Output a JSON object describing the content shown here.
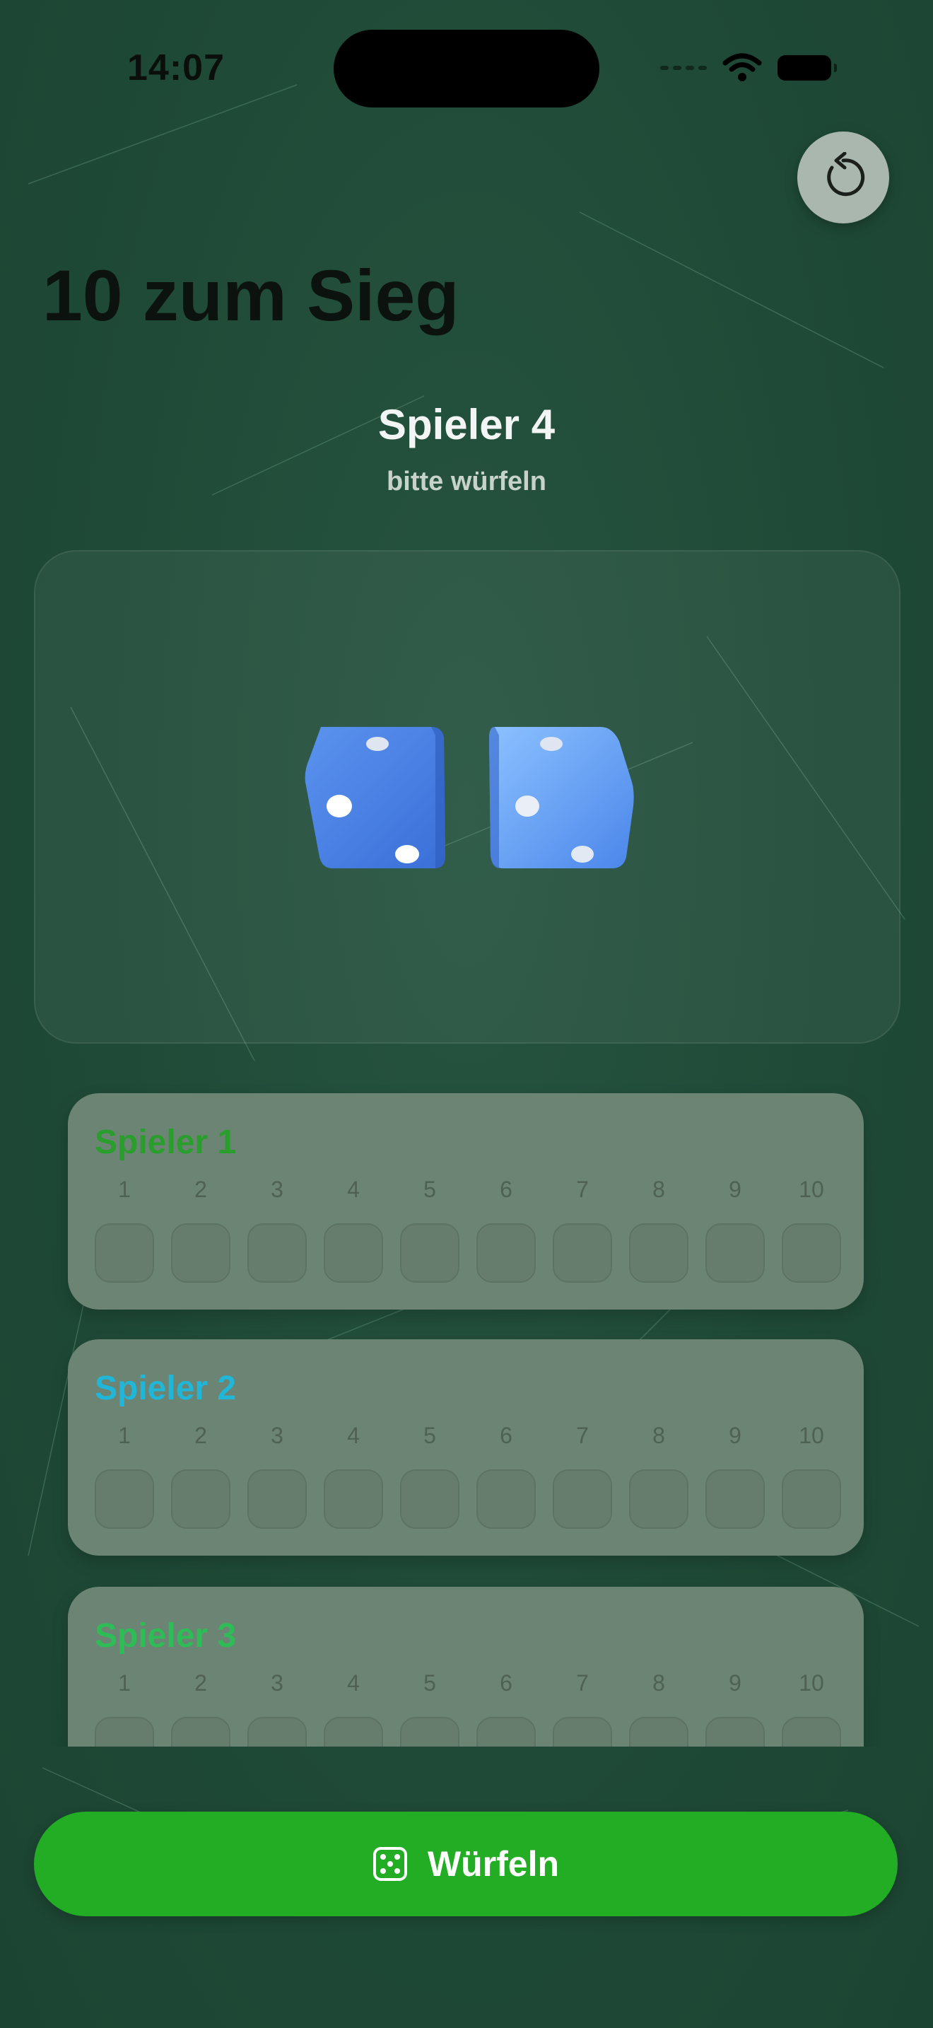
{
  "status_bar": {
    "time": "14:07"
  },
  "header": {
    "title": "10 zum Sieg",
    "reset_icon": "arrow-counterclockwise-icon"
  },
  "turn": {
    "player": "Spieler 4",
    "prompt": "bitte würfeln"
  },
  "dice": {
    "values": [
      3,
      3
    ],
    "color": "#4f86e8"
  },
  "score_numbers": [
    "1",
    "2",
    "3",
    "4",
    "5",
    "6",
    "7",
    "8",
    "9",
    "10"
  ],
  "players": [
    {
      "name": "Spieler 1",
      "color": "#2a9e2c"
    },
    {
      "name": "Spieler 2",
      "color": "#1fb6d8"
    },
    {
      "name": "Spieler 3",
      "color": "#2ebc56"
    }
  ],
  "roll_button": {
    "label": "Würfeln",
    "icon": "die-face-icon",
    "color": "#22ad24"
  }
}
